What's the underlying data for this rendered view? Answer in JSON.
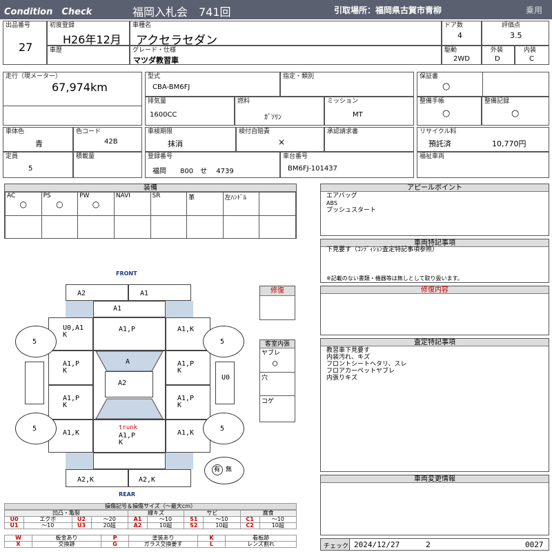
{
  "header": {
    "brand": "Condition　Check",
    "auction": "福岡入札会　741回",
    "pickup": "引取場所：福岡県古賀市青柳",
    "category": "乗用"
  },
  "top": {
    "lot_label": "出品番号",
    "lot_value": "27",
    "first_reg_label": "初度登録",
    "first_reg_value": "H26年12月",
    "car_name_label": "車種名",
    "car_name_value": "アクセラセダン",
    "doors_label": "ドア数",
    "doors_value": "4",
    "score_label": "評価点",
    "score_value": "3.5",
    "history_label": "車歴",
    "grade_label": "グレード・仕様",
    "grade_value": "マツダ教習車",
    "drive_label": "駆動",
    "drive_value": "2WD",
    "exterior_label": "外装",
    "exterior_value": "D",
    "interior_label": "内装",
    "interior_value": "C"
  },
  "spec": {
    "mileage_label": "走行（現メーター）",
    "mileage_value": "67,974km",
    "model_label": "型式",
    "model_value": "CBA-BM6FJ",
    "designation_label": "指定・類別",
    "warranty_label": "保証書",
    "warranty_value": "○",
    "displacement_label": "排気量",
    "displacement_value": "1600CC",
    "fuel_label": "燃料",
    "fuel_value": "ｶﾞｿﾘﾝ",
    "transmission_label": "ミッション",
    "transmission_value": "MT",
    "manual_label": "整備手帳",
    "manual_value": "○",
    "record_label": "整備記録",
    "record_value": "○",
    "color_label": "車体色",
    "color_value": "青",
    "color_code_label": "色コード",
    "color_code_value": "42B",
    "inspection_label": "車検期限",
    "inspection_value": "抹消",
    "insurance_label": "検付自賠責",
    "insurance_value": "×",
    "approval_label": "承認請求書",
    "recycle_label": "リサイクル料",
    "recycle_status": "預託済",
    "recycle_amount": "10,770円",
    "capacity_label": "定員",
    "capacity_value": "5",
    "load_label": "積載量",
    "plate_label": "登録番号",
    "plate_value": "福岡　　800　せ　 4739",
    "chassis_label": "車台番号",
    "chassis_value": "BM6FJ-101437",
    "welfare_label": "福祉車両"
  },
  "equipment": {
    "title": "装備",
    "cells": [
      {
        "label": "AC",
        "mark": "○"
      },
      {
        "label": "PS",
        "mark": "○"
      },
      {
        "label": "PW",
        "mark": "○"
      },
      {
        "label": "NAVI",
        "mark": ""
      },
      {
        "label": "SR",
        "mark": ""
      },
      {
        "label": "革",
        "mark": ""
      },
      {
        "label": "左ﾊﾝﾄﾞﾙ",
        "mark": ""
      }
    ]
  },
  "appeal": {
    "title": "アピールポイント",
    "lines": [
      "エアバッグ",
      "ABS",
      "プッシュスタート"
    ]
  },
  "special": {
    "title": "車両特記事項",
    "line1": "下見要す（ｺﾝﾃﾞｨｼｮﾝ査定特記事項参照）",
    "line2": "※記載のない書類・機器等は無しとして取り扱います。"
  },
  "repair_content": {
    "title": "修復内容"
  },
  "assessment": {
    "title": "査定特記事項",
    "lines": [
      "教習車下見要す",
      "内装汚れ、キズ",
      "フロントシートヘタリ、スレ",
      "フロアカーペットヤブレ",
      "内張りキズ"
    ]
  },
  "changes": {
    "title": "車両変更情報"
  },
  "check": {
    "label": "チェック",
    "date": "2024/12/27",
    "num": "2",
    "code": "0027"
  },
  "diagram": {
    "front": "FRONT",
    "rear": "REAR",
    "trunk": "trunk",
    "repair_label": "修復",
    "cabin_label": "客室内張",
    "cabin_yabure": "ヤブレ",
    "cabin_yabure_mark": "○",
    "cabin_ana": "穴",
    "cabin_koge": "コゲ",
    "tire_label": "5",
    "spare_yes": "有",
    "spare_no": "無",
    "panels": {
      "front_bumper_l": "A2",
      "front_bumper_r": "A1",
      "hood": "A1",
      "lf_fender": "U0,A1\nK",
      "roof_front": "A1,P",
      "rf_fender": "A1,K",
      "lf_door": "A1,P\nK",
      "windshield": "A",
      "rf_door": "A1,P\nK",
      "roof": "A2",
      "side_mirror": "U0",
      "lr_door": "A1,P\nK",
      "rr_door": "A1,P\nK",
      "lr_fender": "A1,K",
      "trunk_mark": "A1,P\nK",
      "rr_fender": "A1,K",
      "rear_bumper_l": "A2,K",
      "rear_bumper_r": "A2,K"
    }
  },
  "legend": {
    "title": "損傷記号＆損傷サイズ（～最大cm）",
    "groups": [
      "凹凸・亀裂",
      "線キズ",
      "サビ",
      "腐食"
    ],
    "row1": [
      "U0",
      "エクボ",
      "U2",
      "～20",
      "A1",
      "～10",
      "S1",
      "～10",
      "C1",
      "～10"
    ],
    "row2": [
      "U1",
      "～10",
      "U3",
      "20超",
      "A2",
      "10超",
      "S2",
      "10超",
      "C2",
      "10超"
    ],
    "row3": [
      "W",
      "板金あり",
      "P",
      "塗装あり",
      "K",
      "看板跡"
    ],
    "row4": [
      "X",
      "交換跡",
      "G",
      "ガラス交換要す",
      "L",
      "レンズ割れ"
    ]
  }
}
